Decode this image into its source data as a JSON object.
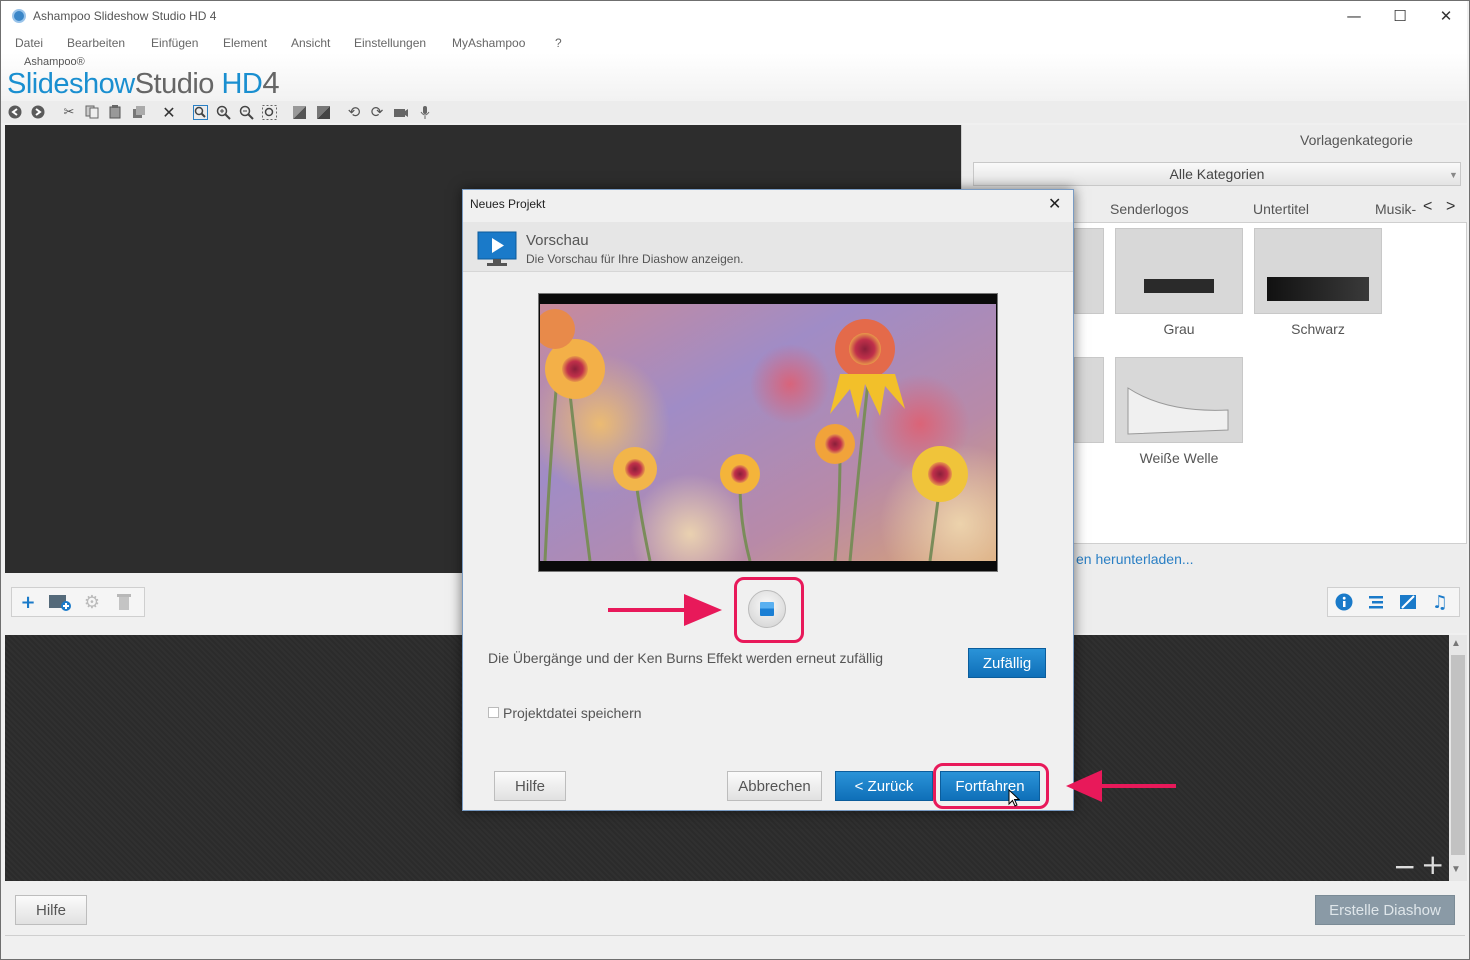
{
  "window": {
    "title": "Ashampoo Slideshow Studio HD 4",
    "controls": {
      "minimize": "—",
      "maximize": "☐",
      "close": "✕"
    }
  },
  "menu": [
    "Datei",
    "Bearbeiten",
    "Einfügen",
    "Element",
    "Ansicht",
    "Einstellungen",
    "MyAshampoo",
    "?"
  ],
  "logo": {
    "brand": "Ashampoo®",
    "name_a": "Slideshow",
    "name_b": "Studio",
    "name_c": "HD",
    "name_d": "4"
  },
  "toolbar_icons": [
    "back-icon",
    "forward-icon",
    "cut-icon",
    "copy-icon",
    "paste-icon",
    "duplicate-icon",
    "delete-icon",
    "zoom-fit-icon",
    "zoom-in-icon",
    "zoom-out-icon",
    "zoom-select-icon",
    "effect-a-icon",
    "effect-b-icon",
    "rotate-left-icon",
    "rotate-right-icon",
    "camera-icon",
    "microphone-icon"
  ],
  "right_panel": {
    "category_label": "Vorlagenkategorie",
    "category_value": "Alle Kategorien",
    "tabs": [
      "Senderlogos",
      "Untertitel",
      "Musik-"
    ],
    "templates": [
      {
        "label": "Grau"
      },
      {
        "label": "Schwarz"
      },
      {
        "label": "Weiße Welle"
      }
    ],
    "download_link": "en herunterladen..."
  },
  "zoom": {
    "minus": "−",
    "plus": "+"
  },
  "footer": {
    "help": "Hilfe",
    "create": "Erstelle Diashow"
  },
  "dialog": {
    "title": "Neues Projekt",
    "close": "✕",
    "heading": "Vorschau",
    "subheading": "Die Vorschau für Ihre Diashow anzeigen.",
    "info_text": "Die Übergänge und der Ken Burns Effekt werden erneut zufällig",
    "random_button": "Zufällig",
    "save_checkbox_label": "Projektdatei speichern",
    "save_checked": false,
    "help_button": "Hilfe",
    "cancel_button": "Abbrechen",
    "back_button": "< Zurück",
    "next_button": "Fortfahren"
  },
  "colors": {
    "accent": "#1580cf",
    "highlight": "#e8195a",
    "dark_bg": "#2d2d2d"
  }
}
